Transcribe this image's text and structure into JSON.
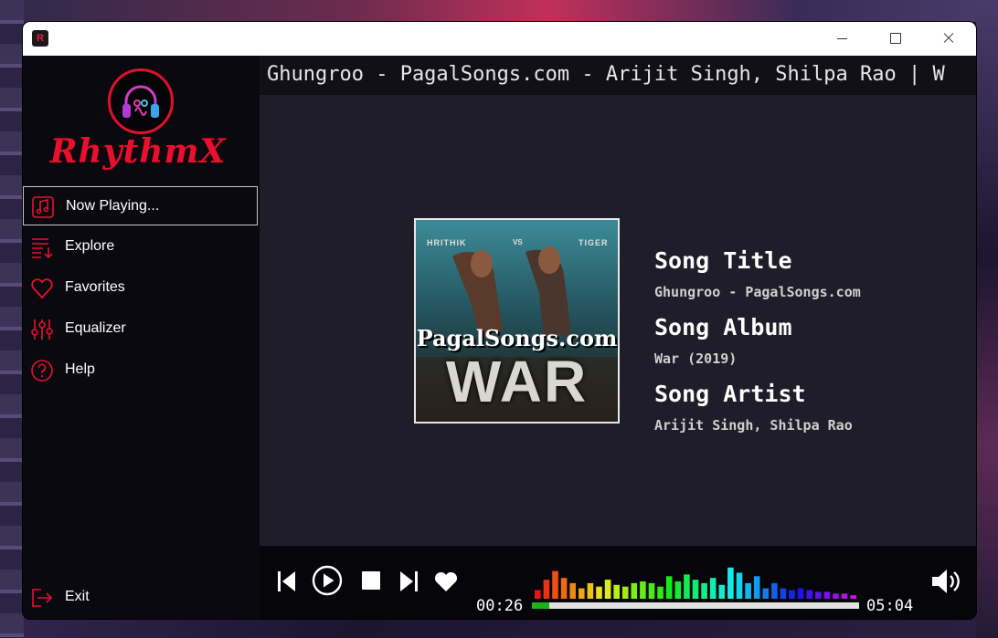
{
  "app": {
    "name": "RhythmX",
    "icon": "app-logo-icon"
  },
  "window_controls": [
    "minimize-icon",
    "maximize-icon",
    "close-icon"
  ],
  "sidebar": {
    "logo_text": "RhythmX",
    "items": [
      {
        "label": "Now Playing...",
        "icon": "music-note-icon",
        "active": true
      },
      {
        "label": "Explore",
        "icon": "playlist-icon",
        "active": false
      },
      {
        "label": "Favorites",
        "icon": "heart-icon",
        "active": false
      },
      {
        "label": "Equalizer",
        "icon": "equalizer-icon",
        "active": false
      },
      {
        "label": "Help",
        "icon": "help-icon",
        "active": false
      }
    ],
    "exit_label": "Exit"
  },
  "marquee": "Ghungroo - PagalSongs.com - Arijit Singh, Shilpa Rao | W",
  "song": {
    "cover_texts": {
      "left_name": "HRITHIK",
      "vs": "VS",
      "right_name": "TIGER",
      "watermark": "PagalSongs.com",
      "title": "WAR"
    },
    "title_heading": "Song Title",
    "title": "Ghungroo - PagalSongs.com",
    "album_heading": "Song Album",
    "album": "War (2019)",
    "artist_heading": "Song Artist",
    "artist": "Arijit Singh, Shilpa Rao"
  },
  "player": {
    "current_time": "00:26",
    "total_time": "05:04",
    "progress_fraction": 0.052,
    "icons": [
      "previous-icon",
      "play-icon",
      "stop-icon",
      "next-icon",
      "favorite-icon",
      "volume-icon"
    ],
    "spectrum": [
      0.25,
      0.55,
      0.8,
      0.6,
      0.45,
      0.3,
      0.45,
      0.35,
      0.55,
      0.4,
      0.35,
      0.45,
      0.5,
      0.45,
      0.35,
      0.65,
      0.5,
      0.7,
      0.55,
      0.45,
      0.6,
      0.4,
      0.9,
      0.75,
      0.45,
      0.65,
      0.3,
      0.45,
      0.3,
      0.25,
      0.3,
      0.25,
      0.2,
      0.2,
      0.15,
      0.15,
      0.1
    ]
  },
  "colors": {
    "accent": "#e8102e",
    "sidebar_bg": "#0b0910",
    "main_bg": "#1f1d29",
    "progress": "#1bb21b"
  }
}
